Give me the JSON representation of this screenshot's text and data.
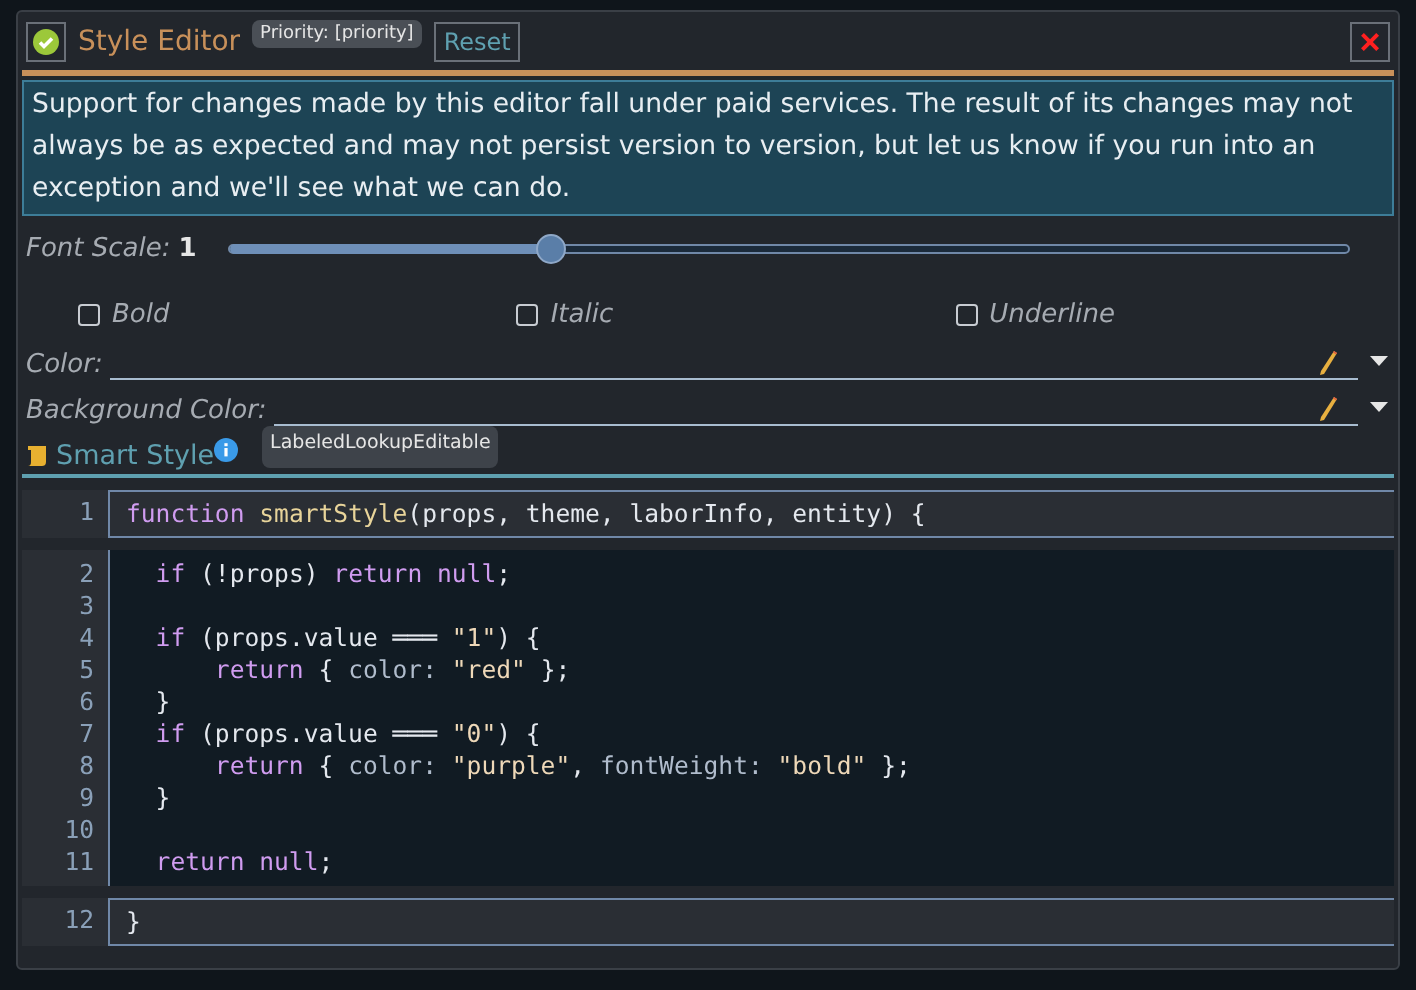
{
  "window": {
    "title": "Style Editor",
    "badge": "Priority: [priority]",
    "reset": "Reset",
    "close": "×"
  },
  "notice": "Support for changes made by this editor fall under paid services. The result of its changes may not always be as expected and may not persist version to version, but let us know if you run into an exception and we'll see what we can do.",
  "font_scale": {
    "label": "Font Scale:",
    "value": "1",
    "level": 0.286
  },
  "checkboxes": [
    {
      "label": "Bold",
      "checked": false
    },
    {
      "label": "Italic",
      "checked": false
    },
    {
      "label": "Underline",
      "checked": false
    }
  ],
  "color_fields": [
    {
      "label": "Color:"
    },
    {
      "label": "Background Color:"
    }
  ],
  "smart_style": {
    "title": "Smart Style",
    "tooltip": "LabeledLookupEditable"
  },
  "code_sections": [
    {
      "lines": [
        {
          "number": "1",
          "tokens": [
            {
              "kind": "kw",
              "text": "function"
            },
            {
              "kind": "fn",
              "text": " smartStyle"
            },
            {
              "kind": "plain",
              "text": "(props, theme, laborInfo, entity) {"
            }
          ]
        }
      ]
    },
    {
      "lines": [
        {
          "number": "2",
          "tokens": [
            {
              "kind": "kw",
              "text": "  if"
            },
            {
              "kind": "plain",
              "text": " (!props) "
            },
            {
              "kind": "kw",
              "text": "return null"
            },
            {
              "kind": "plain",
              "text": ";"
            }
          ]
        },
        {
          "number": "3"
        },
        {
          "number": "4",
          "tokens": [
            {
              "kind": "kw",
              "text": "  if"
            },
            {
              "kind": "plain",
              "text": " (props.value ═══ "
            },
            {
              "kind": "str",
              "text": "\"1\""
            },
            {
              "kind": "plain",
              "text": ") {"
            }
          ]
        },
        {
          "number": "5",
          "tokens": [
            {
              "kind": "kw",
              "text": "      return"
            },
            {
              "kind": "plain",
              "text": " { "
            },
            {
              "kind": "prop",
              "text": "color: "
            },
            {
              "kind": "str",
              "text": "\"red\""
            },
            {
              "kind": "plain",
              "text": " };"
            }
          ]
        },
        {
          "number": "6",
          "tokens": [
            {
              "kind": "plain",
              "text": "  }"
            }
          ]
        },
        {
          "number": "7",
          "tokens": [
            {
              "kind": "kw",
              "text": "  if"
            },
            {
              "kind": "plain",
              "text": " (props.value ═══ "
            },
            {
              "kind": "str",
              "text": "\"0\""
            },
            {
              "kind": "plain",
              "text": ") {"
            }
          ]
        },
        {
          "number": "8",
          "tokens": [
            {
              "kind": "kw",
              "text": "      return"
            },
            {
              "kind": "plain",
              "text": " { "
            },
            {
              "kind": "prop",
              "text": "color: "
            },
            {
              "kind": "str",
              "text": "\"purple\""
            },
            {
              "kind": "plain",
              "text": ", "
            },
            {
              "kind": "prop",
              "text": "fontWeight: "
            },
            {
              "kind": "str",
              "text": "\"bold\""
            },
            {
              "kind": "plain",
              "text": " };"
            }
          ]
        },
        {
          "number": "9",
          "tokens": [
            {
              "kind": "plain",
              "text": "  }"
            }
          ]
        },
        {
          "number": "10"
        },
        {
          "number": "11",
          "tokens": [
            {
              "kind": "kw",
              "text": "  return null"
            },
            {
              "kind": "plain",
              "text": ";"
            }
          ]
        }
      ]
    },
    {
      "lines": [
        {
          "number": "12",
          "tokens": [
            {
              "kind": "plain",
              "text": "}"
            }
          ]
        }
      ]
    }
  ]
}
